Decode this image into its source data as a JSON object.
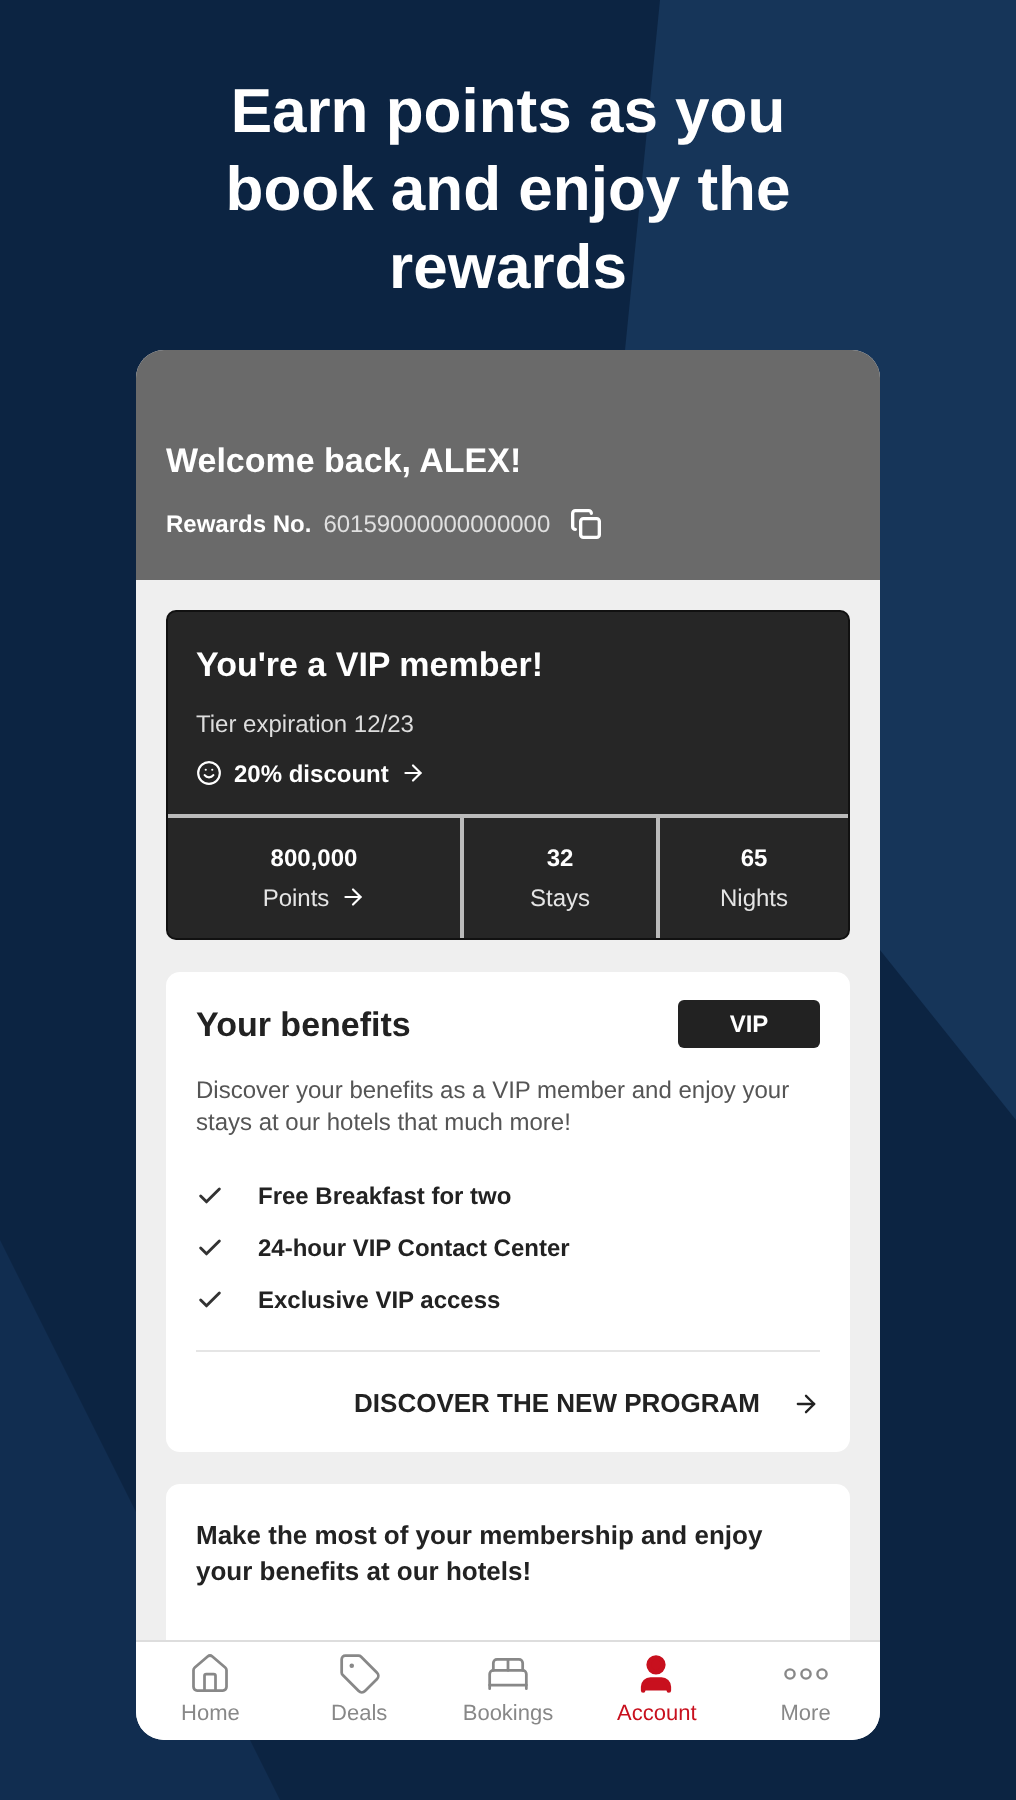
{
  "headline": "Earn points as you book and enjoy the rewards",
  "header": {
    "greeting": "Welcome back, ALEX!",
    "rewards_label": "Rewards No.",
    "rewards_number": "60159000000000000"
  },
  "vip_card": {
    "title": "You're a VIP member!",
    "expiration": "Tier expiration 12/23",
    "discount": "20% discount",
    "stats": [
      {
        "value": "800,000",
        "label": "Points",
        "link": true
      },
      {
        "value": "32",
        "label": "Stays",
        "link": false
      },
      {
        "value": "65",
        "label": "Nights",
        "link": false
      }
    ]
  },
  "benefits": {
    "title": "Your benefits",
    "badge": "VIP",
    "description": "Discover your benefits as a VIP member and enjoy your stays at our hotels that much more!",
    "items": [
      "Free Breakfast for two",
      "24-hour VIP Contact Center",
      "Exclusive VIP access"
    ],
    "link": "DISCOVER THE NEW PROGRAM"
  },
  "promo": {
    "text": "Make the most of your membership and enjoy your benefits at our hotels!"
  },
  "nav": [
    {
      "label": "Home",
      "kind": "home",
      "selected": false
    },
    {
      "label": "Deals",
      "kind": "deals",
      "selected": false
    },
    {
      "label": "Bookings",
      "kind": "bookings",
      "selected": false
    },
    {
      "label": "Account",
      "kind": "account",
      "selected": true
    },
    {
      "label": "More",
      "kind": "more",
      "selected": false
    }
  ]
}
